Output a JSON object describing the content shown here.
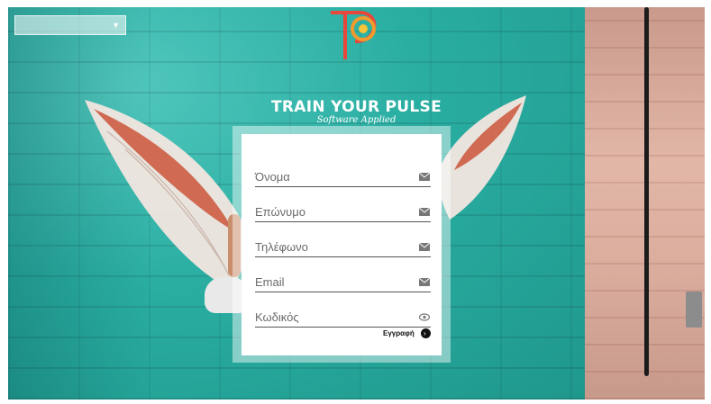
{
  "language_select": {
    "value": ""
  },
  "brand": {
    "title": "TRAIN YOUR PULSE",
    "subtitle": "Software Applied"
  },
  "form": {
    "fields": [
      {
        "label": "Όνομα",
        "icon": "envelope-icon"
      },
      {
        "label": "Επώνυμο",
        "icon": "envelope-icon"
      },
      {
        "label": "Τηλέφωνο",
        "icon": "envelope-icon"
      },
      {
        "label": "Email",
        "icon": "envelope-icon"
      },
      {
        "label": "Κωδικός",
        "icon": "eye-icon"
      }
    ],
    "register_label": "Εγγραφή"
  },
  "colors": {
    "wall": "#2fb3a6",
    "logo_orange": "#f39a2d",
    "logo_red": "#e8473b"
  }
}
